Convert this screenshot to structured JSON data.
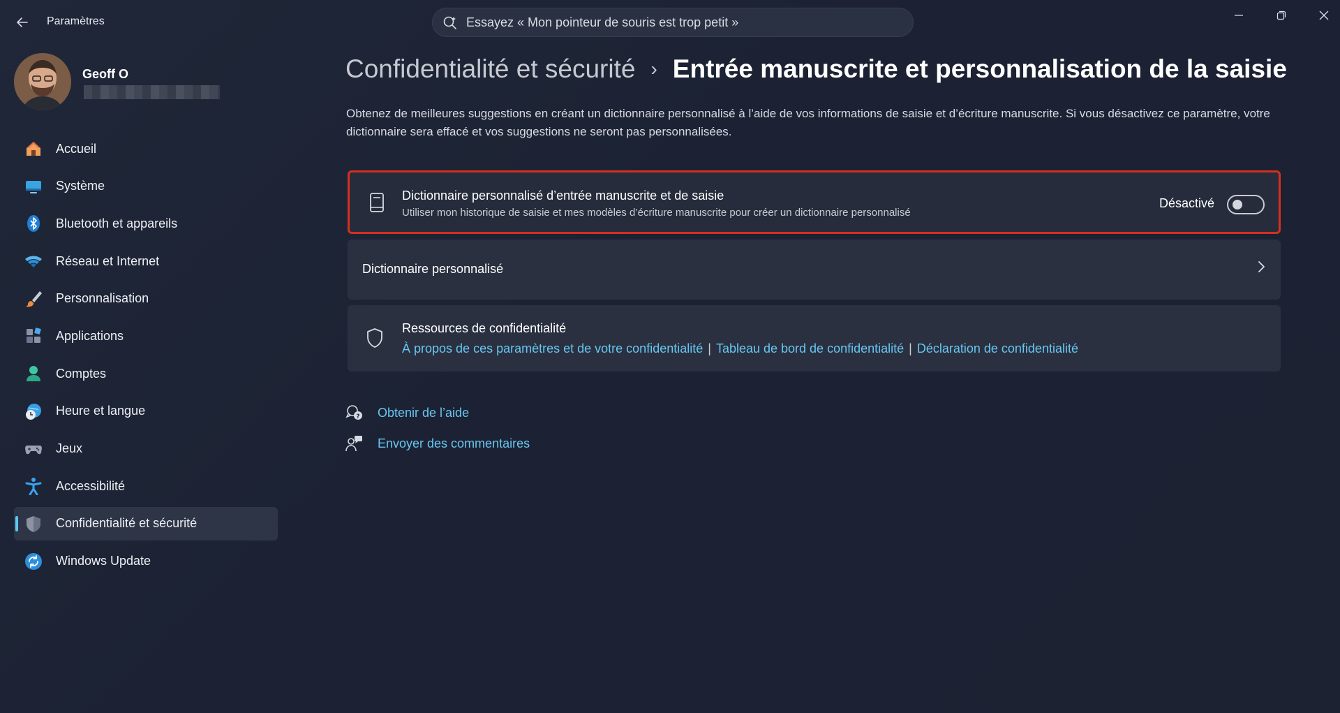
{
  "app": {
    "title": "Paramètres",
    "search_placeholder": "Essayez « Mon pointeur de souris est trop petit »"
  },
  "profile": {
    "name": "Geoff O"
  },
  "sidebar": {
    "items": [
      {
        "label": "Accueil",
        "icon": "home-icon"
      },
      {
        "label": "Système",
        "icon": "system-icon"
      },
      {
        "label": "Bluetooth et appareils",
        "icon": "bluetooth-icon"
      },
      {
        "label": "Réseau et Internet",
        "icon": "wifi-icon"
      },
      {
        "label": "Personnalisation",
        "icon": "brush-icon"
      },
      {
        "label": "Applications",
        "icon": "apps-icon"
      },
      {
        "label": "Comptes",
        "icon": "account-icon"
      },
      {
        "label": "Heure et langue",
        "icon": "time-language-icon"
      },
      {
        "label": "Jeux",
        "icon": "gamepad-icon"
      },
      {
        "label": "Accessibilité",
        "icon": "accessibility-icon"
      },
      {
        "label": "Confidentialité et sécurité",
        "icon": "shield-icon",
        "active": true
      },
      {
        "label": "Windows Update",
        "icon": "update-icon"
      }
    ]
  },
  "main": {
    "breadcrumb_parent": "Confidentialité et sécurité",
    "breadcrumb_separator": "›",
    "title": "Entrée manuscrite et personnalisation de la saisie",
    "description": "Obtenez de meilleures suggestions en créant un dictionnaire personnalisé à l’aide de vos informations de saisie et d’écriture manuscrite. Si vous désactivez ce paramètre, votre dictionnaire sera effacé et vos suggestions ne seront pas personnalisées.",
    "toggle_card": {
      "title": "Dictionnaire personnalisé d’entrée manuscrite et de saisie",
      "subtitle": "Utiliser mon historique de saisie et mes modèles d’écriture manuscrite pour créer un dictionnaire personnalisé",
      "state_label": "Désactivé",
      "enabled": false,
      "highlight_color": "#d4301f"
    },
    "dictionary_card": {
      "label": "Dictionnaire personnalisé"
    },
    "resources_card": {
      "title": "Ressources de confidentialité",
      "links": [
        "À propos de ces paramètres et de votre confidentialité",
        "Tableau de bord de confidentialité",
        "Déclaration de confidentialité"
      ],
      "separator": "|"
    },
    "help": {
      "get_help": "Obtenir de l’aide",
      "feedback": "Envoyer des commentaires"
    }
  },
  "colors": {
    "accent": "#5ec8f3",
    "link": "#68c6f0"
  }
}
